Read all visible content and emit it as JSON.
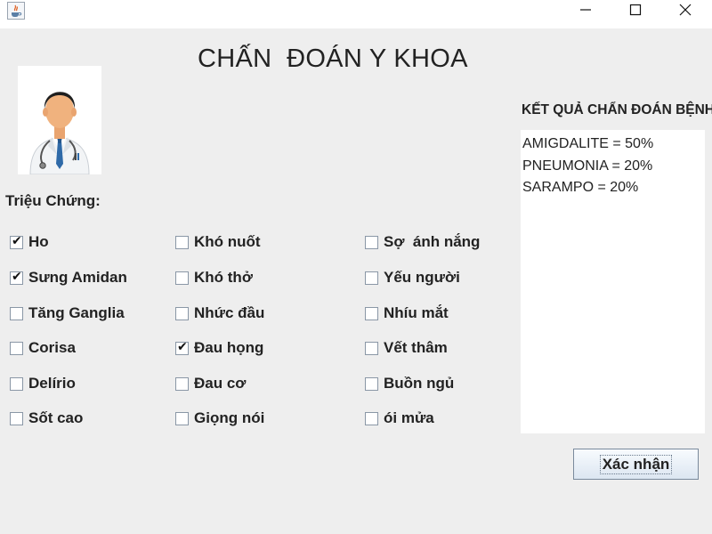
{
  "window": {
    "app_icon": "java-cup-icon",
    "controls": [
      "minimize-icon",
      "maximize-icon",
      "close-icon"
    ]
  },
  "header": {
    "title": "CHẤN  ĐOÁN Y KHOA"
  },
  "avatar": {
    "icon": "doctor-avatar-icon"
  },
  "symptoms": {
    "label": "Triệu Chứng:",
    "items": [
      {
        "label": "Ho",
        "checked": true
      },
      {
        "label": "Sưng Amidan",
        "checked": true
      },
      {
        "label": "Tăng Ganglia",
        "checked": false
      },
      {
        "label": "Corisa",
        "checked": false
      },
      {
        "label": "Delírio",
        "checked": false
      },
      {
        "label": "Sốt cao",
        "checked": false
      },
      {
        "label": "Khó nuốt",
        "checked": false
      },
      {
        "label": "Khó thở",
        "checked": false
      },
      {
        "label": "Nhức đầu",
        "checked": false
      },
      {
        "label": "Đau họng",
        "checked": true
      },
      {
        "label": "Đau cơ",
        "checked": false
      },
      {
        "label": "Giọng nói",
        "checked": false
      },
      {
        "label": "Sợ  ánh nắng",
        "checked": false
      },
      {
        "label": "Yếu người",
        "checked": false
      },
      {
        "label": "Nhíu mắt",
        "checked": false
      },
      {
        "label": "Vết thâm",
        "checked": false
      },
      {
        "label": "Buồn ngủ",
        "checked": false
      },
      {
        "label": "ói mửa",
        "checked": false
      }
    ]
  },
  "results": {
    "label": "KẾT QUẢ CHẨN ĐOÁN BỆNH",
    "lines": [
      "AMIGDALITE = 50%",
      "PNEUMONIA = 20%",
      "SARAMPO = 20%"
    ]
  },
  "actions": {
    "confirm_label": "Xác nhận"
  }
}
